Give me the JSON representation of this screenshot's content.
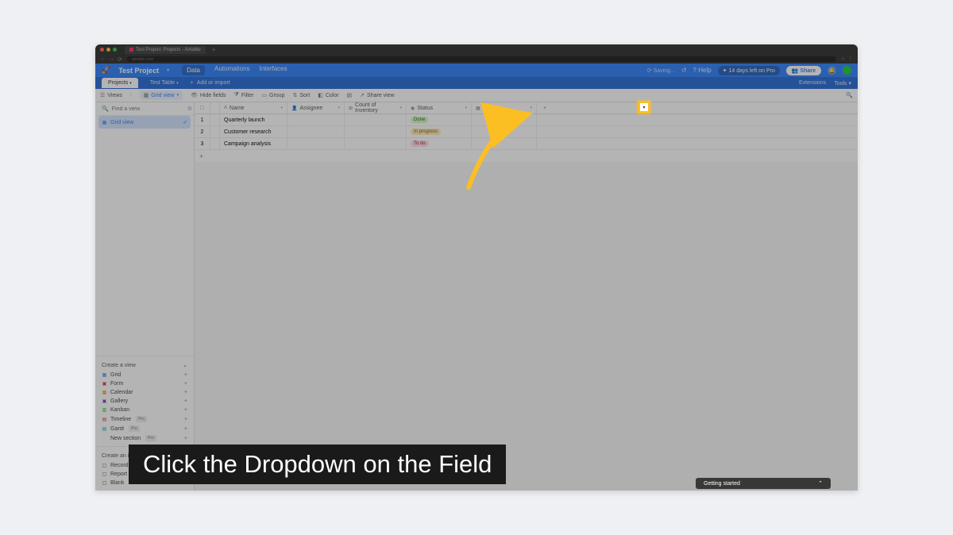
{
  "browser": {
    "tab_title": "Test Project: Projects - Airtable",
    "url": "airtable.com"
  },
  "header": {
    "base_name": "Test Project",
    "nav": {
      "data": "Data",
      "automations": "Automations",
      "interfaces": "Interfaces"
    },
    "saving": "Saving...",
    "help": "Help",
    "trial": "14 days left on Pro",
    "share": "Share"
  },
  "tables": {
    "projects": "Projects",
    "test_table": "Test Table",
    "add_import": "Add or import"
  },
  "tabs_right": {
    "extensions": "Extensions",
    "tools": "Tools"
  },
  "toolbar": {
    "views": "Views",
    "grid_view": "Grid view",
    "hide_fields": "Hide fields",
    "filter": "Filter",
    "group": "Group",
    "sort": "Sort",
    "color": "Color",
    "share_view": "Share view"
  },
  "sidebar": {
    "find_placeholder": "Find a view",
    "grid_view": "Grid view",
    "create_view": "Create a view",
    "views": {
      "grid": "Grid",
      "form": "Form",
      "calendar": "Calendar",
      "gallery": "Gallery",
      "kanban": "Kanban",
      "timeline": "Timeline",
      "gantt": "Gantt",
      "new_section": "New section"
    },
    "pro": "Pro",
    "create_interface": "Create an interface",
    "interfaces": {
      "record_review": "Record review",
      "report": "Report",
      "blank": "Blank"
    }
  },
  "grid": {
    "columns": {
      "name": "Name",
      "assignee": "Assignee",
      "count": "Count of Inventory",
      "status": "Status"
    },
    "rows": [
      {
        "n": "1",
        "name": "Quarterly launch",
        "status": "Done",
        "status_class": "st-done"
      },
      {
        "n": "2",
        "name": "Customer research",
        "status": "In progress",
        "status_class": "st-progress"
      },
      {
        "n": "3",
        "name": "Campaign analysis",
        "status": "To do",
        "status_class": "st-todo"
      }
    ]
  },
  "caption": "Click the Dropdown on the Field",
  "getting_started": "Getting started"
}
